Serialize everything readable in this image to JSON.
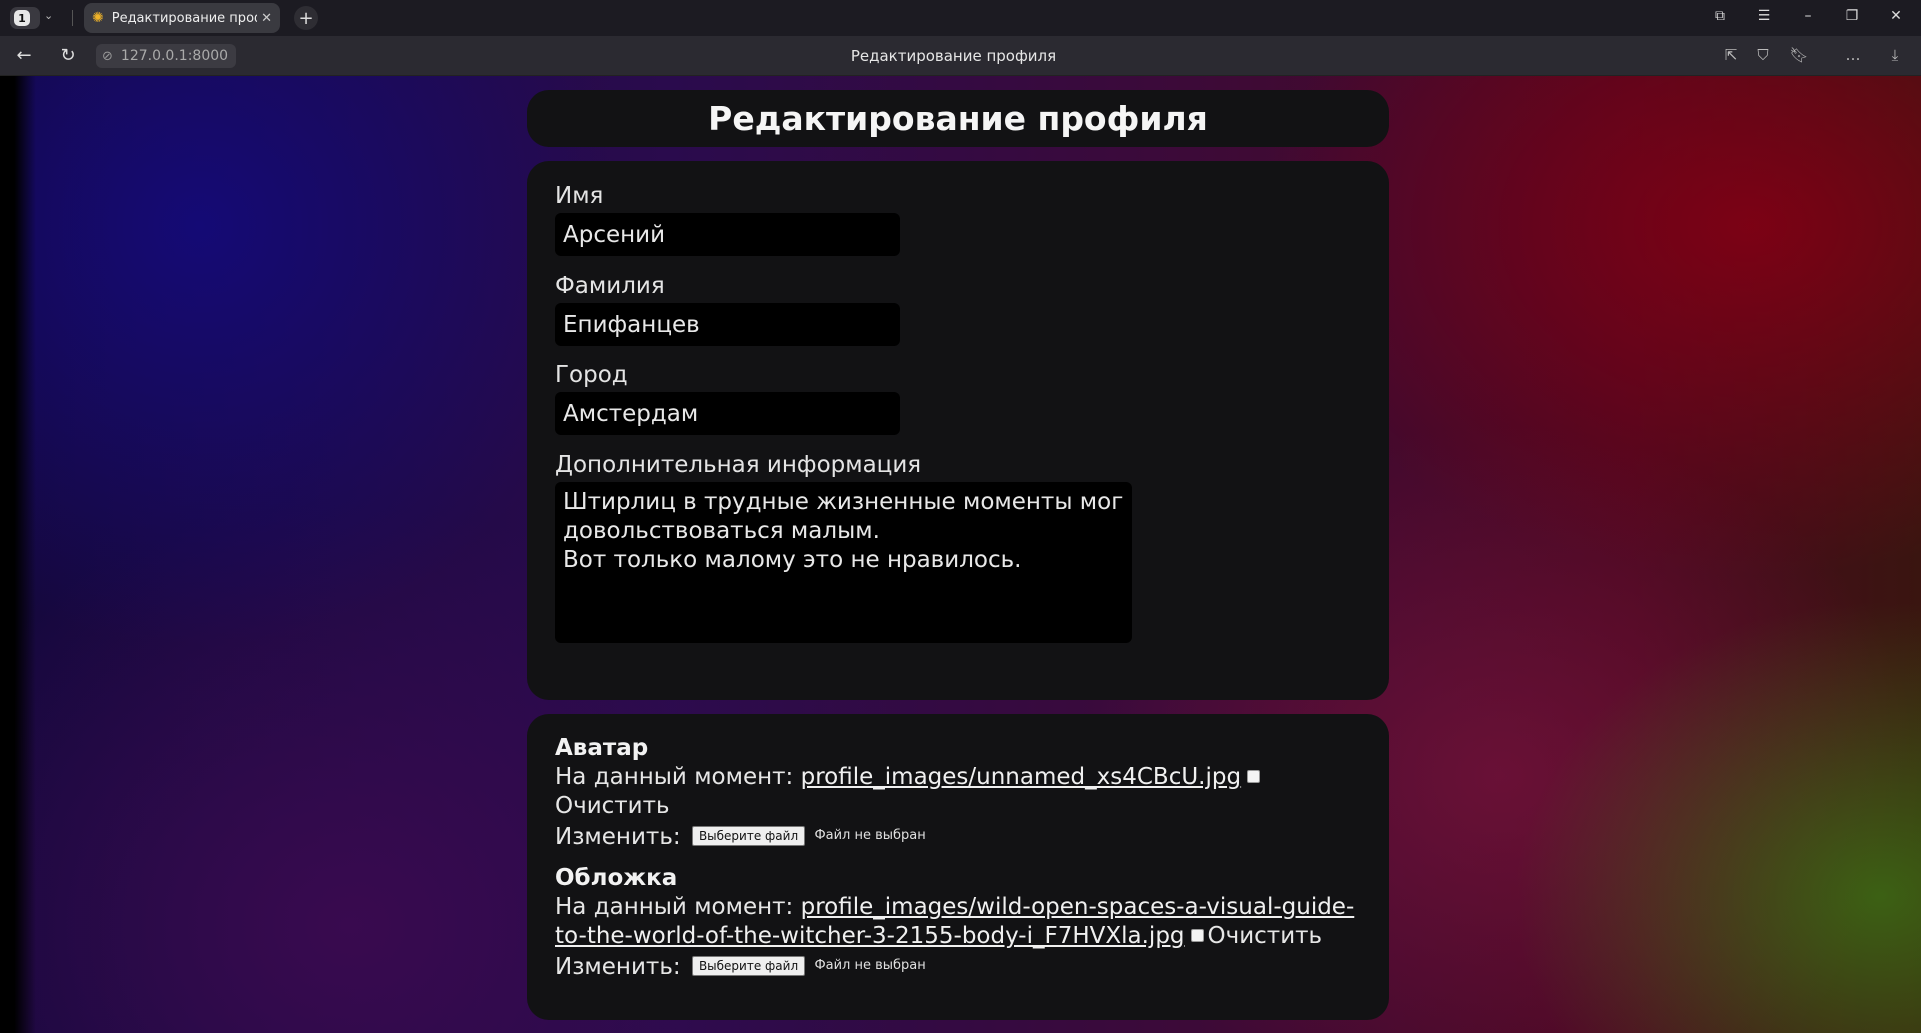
{
  "browser": {
    "tab_count": "1",
    "tab_title": "Редактирование проф",
    "url": "127.0.0.1:8000",
    "page_title": "Редактирование профиля",
    "icons": [
      "tab-list-chevron-icon",
      "favicon-sun-icon",
      "close-icon",
      "plus-icon",
      "collections-icon",
      "menu-icon",
      "minimize-icon",
      "restore-icon",
      "close-window-icon",
      "back-icon",
      "reload-icon",
      "site-info-icon",
      "share-icon",
      "extensions-icon",
      "bookmark-icon",
      "more-icon",
      "download-icon"
    ]
  },
  "page": {
    "heading": "Редактирование профиля",
    "form": {
      "first_name_label": "Имя",
      "first_name_value": "Арсений",
      "last_name_label": "Фамилия",
      "last_name_value": "Епифанцев",
      "city_label": "Город",
      "city_value": "Амстердам",
      "info_label": "Дополнительная информация",
      "info_value": "Штирлиц в трудные жизненные моменты мог\nдовольствоваться малым.\nВот только малому это не нравилось."
    },
    "avatar": {
      "title": "Аватар",
      "current_label": "На данный момент:",
      "current_file": "profile_images/unnamed_xs4CBcU.jpg",
      "clear_label": "Очистить",
      "change_label": "Изменить:",
      "choose_button": "Выберите файл",
      "no_file": "Файл не выбран"
    },
    "cover": {
      "title": "Обложка",
      "current_label": "На данный момент:",
      "current_file_line1": "profile_images/wild-open-spaces-a-visual-guide-",
      "current_file_line2": "to-the-world-of-the-witcher-3-2155-body-i_F7HVXla.jpg",
      "clear_label": "Очистить",
      "change_label": "Изменить:",
      "choose_button": "Выберите файл",
      "no_file": "Файл не выбран"
    }
  },
  "colors": {
    "card_bg": "#121214",
    "input_bg": "#000000",
    "chrome_bg": "#1c1b22",
    "navbar_bg": "#2b2a31"
  }
}
